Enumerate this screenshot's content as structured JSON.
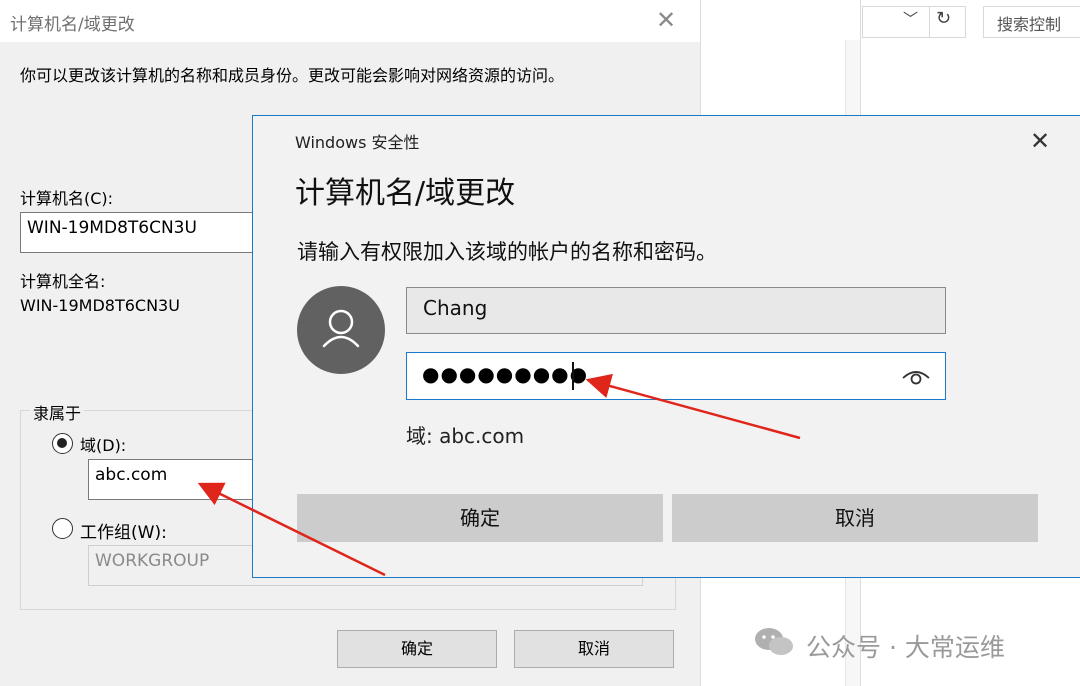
{
  "bg_dialog": {
    "title": "计算机名/域更改",
    "description": "你可以更改该计算机的名称和成员身份。更改可能会影响对网络资源的访问。",
    "computer_name_label": "计算机名(C):",
    "computer_name_value": "WIN-19MD8T6CN3U",
    "full_name_label": "计算机全名:",
    "full_name_value": "WIN-19MD8T6CN3U",
    "member_of_label": "隶属于",
    "domain_radio_label": "域(D):",
    "domain_value": "abc.com",
    "workgroup_radio_label": "工作组(W):",
    "workgroup_value": "WORKGROUP",
    "ok_label": "确定",
    "cancel_label": "取消"
  },
  "right_panel": {
    "search_placeholder": "搜索控制"
  },
  "security_dialog": {
    "header": "Windows 安全性",
    "title": "计算机名/域更改",
    "description": "请输入有权限加入该域的帐户的名称和密码。",
    "username_value": "Chang",
    "password_mask": "●●●●●●●●●",
    "domain_line": "域: abc.com",
    "ok_label": "确定",
    "cancel_label": "取消"
  },
  "watermark": {
    "text": "公众号 · 大常运维"
  },
  "colors": {
    "accent": "#1979ca",
    "arrow": "#e0251b",
    "button_gray": "#cccccc"
  }
}
